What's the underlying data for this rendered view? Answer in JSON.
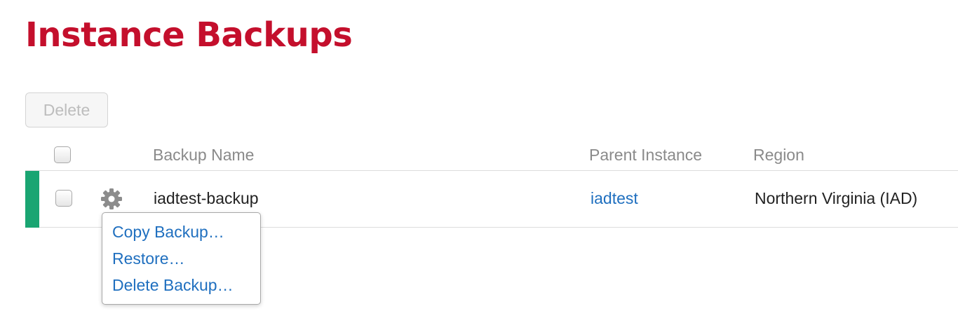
{
  "page": {
    "title": "Instance Backups"
  },
  "toolbar": {
    "delete_label": "Delete"
  },
  "table": {
    "columns": [
      "Backup Name",
      "Parent Instance",
      "Region"
    ],
    "rows": [
      {
        "backup_name": "iadtest-backup",
        "parent_instance": "iadtest",
        "region": "Northern Virginia (IAD)"
      }
    ]
  },
  "context_menu": {
    "items": [
      "Copy Backup…",
      "Restore…",
      "Delete Backup…"
    ]
  },
  "colors": {
    "title": "#c40f2c",
    "link": "#1f6fbf",
    "row_accent": "#1aa572"
  }
}
